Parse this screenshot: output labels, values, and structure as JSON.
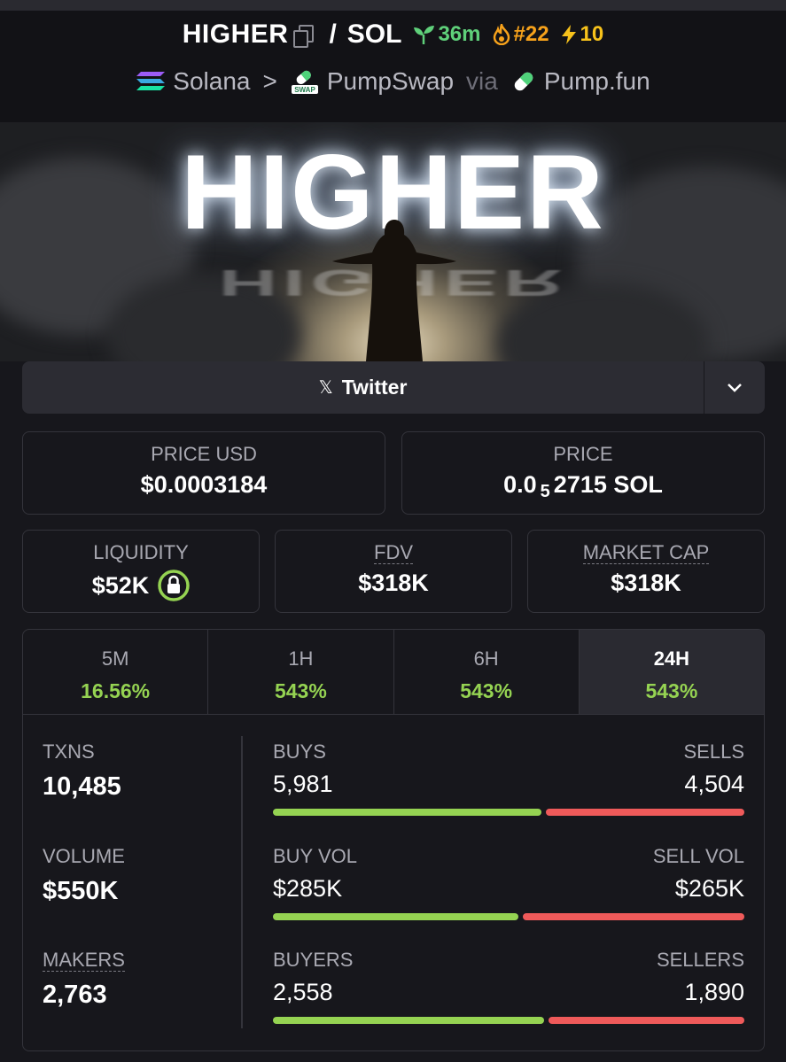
{
  "header": {
    "symbol": "HIGHER",
    "slash": "/",
    "quote": "SOL",
    "age": "36m",
    "rank": "#22",
    "boosts": "10",
    "chain": "Solana",
    "crumb_sep": ">",
    "dex": "PumpSwap",
    "via": "via",
    "launchpad": "Pump.fun"
  },
  "banner": {
    "text": "HIGHER"
  },
  "social": {
    "label": "Twitter",
    "x_glyph": "𝕏"
  },
  "price_usd": {
    "label": "PRICE USD",
    "value": "$0.0003184"
  },
  "price_native": {
    "label": "PRICE",
    "prefix": "0.0",
    "subscript": "5",
    "suffix": "2715 SOL"
  },
  "liquidity": {
    "label": "LIQUIDITY",
    "value": "$52K"
  },
  "fdv": {
    "label": "FDV",
    "value": "$318K"
  },
  "market_cap": {
    "label": "MARKET CAP",
    "value": "$318K"
  },
  "tabs": [
    {
      "label": "5M",
      "value": "16.56%"
    },
    {
      "label": "1H",
      "value": "543%"
    },
    {
      "label": "6H",
      "value": "543%"
    },
    {
      "label": "24H",
      "value": "543%"
    }
  ],
  "metrics": {
    "txns": {
      "label": "TXNS",
      "value": "10,485"
    },
    "volume": {
      "label": "VOLUME",
      "value": "$550K"
    },
    "makers": {
      "label": "MAKERS",
      "value": "2,763"
    }
  },
  "splits": {
    "txns": {
      "left_label": "BUYS",
      "right_label": "SELLS",
      "left_value": "5,981",
      "right_value": "4,504",
      "left_fraction": 0.57
    },
    "volume": {
      "left_label": "BUY VOL",
      "right_label": "SELL VOL",
      "left_value": "$285K",
      "right_value": "$265K",
      "left_fraction": 0.52
    },
    "makers": {
      "left_label": "BUYERS",
      "right_label": "SELLERS",
      "left_value": "2,558",
      "right_value": "1,890",
      "left_fraction": 0.575
    }
  },
  "colors": {
    "positive": "#95d352",
    "negative": "#ef5a5a",
    "age": "#5fd07a",
    "rank": "#f7a21b"
  }
}
